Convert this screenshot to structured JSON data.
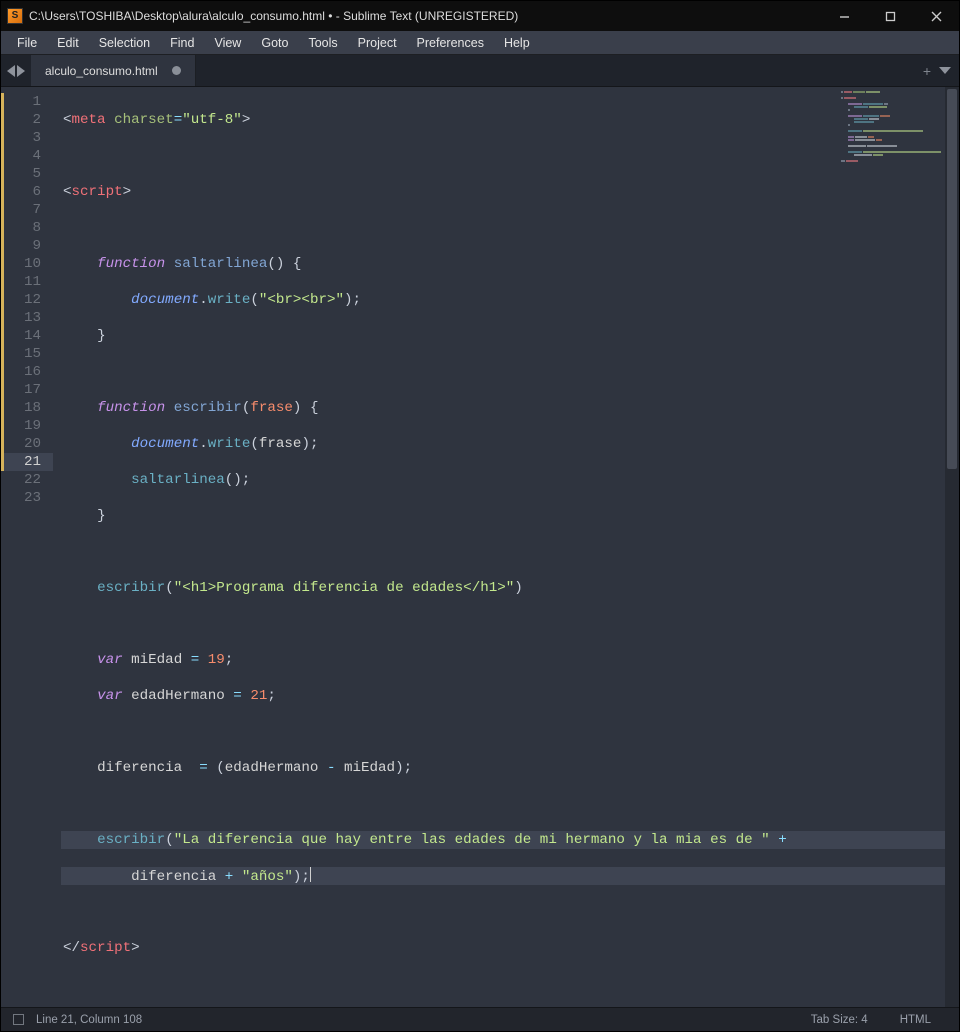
{
  "titlebar": {
    "path": "C:\\Users\\TOSHIBA\\Desktop\\alura\\alculo_consumo.html • - Sublime Text (UNREGISTERED)"
  },
  "menu": {
    "file": "File",
    "edit": "Edit",
    "selection": "Selection",
    "find": "Find",
    "view": "View",
    "goto": "Goto",
    "tools": "Tools",
    "project": "Project",
    "preferences": "Preferences",
    "help": "Help"
  },
  "tab": {
    "name": "alculo_consumo.html"
  },
  "status": {
    "pos": "Line 21, Column 108",
    "tabsize": "Tab Size: 4",
    "syntax": "HTML"
  },
  "code": {
    "lines": 23,
    "active_line": 21
  }
}
